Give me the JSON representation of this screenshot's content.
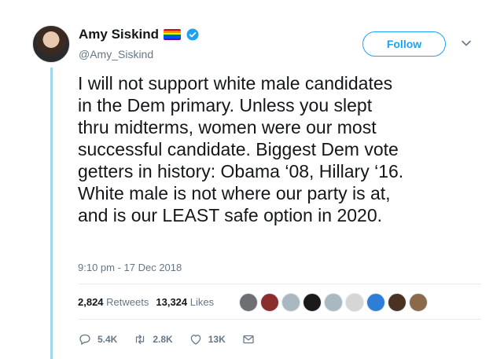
{
  "tweet": {
    "display_name": "Amy Siskind",
    "handle": "@Amy_Siskind",
    "verified_icon": "verified-badge-icon",
    "flag_icon": "rainbow-flag-icon",
    "follow_label": "Follow",
    "text_lines": [
      "I will not support white male candidates",
      "in the Dem primary. Unless you slept",
      "thru midterms, women were our most",
      "successful candidate. Biggest Dem vote",
      "getters in history: Obama ‘08, Hillary ‘16.",
      "White male is not where our party is at,",
      "and is our LEAST safe option in 2020."
    ],
    "timestamp": "9:10 pm - 17 Dec 2018"
  },
  "stats": {
    "retweets_count": "2,824",
    "retweets_label": "Retweets",
    "likes_count": "13,324",
    "likes_label": "Likes"
  },
  "actions": {
    "reply_count": "5.4K",
    "retweet_count": "2.8K",
    "like_count": "13K"
  },
  "colors": {
    "brand_blue": "#1da1f2",
    "thread_line": "#9fd8e8",
    "muted_text": "#657786"
  },
  "likers": [
    {
      "name": "liker-avatar-1",
      "color": "#6d6f73"
    },
    {
      "name": "liker-avatar-2",
      "color": "#8c2d2d"
    },
    {
      "name": "liker-avatar-3",
      "color": "#aab8c2"
    },
    {
      "name": "liker-avatar-4",
      "color": "#1a1a1a"
    },
    {
      "name": "liker-avatar-5",
      "color": "#aab8c2"
    },
    {
      "name": "liker-avatar-6",
      "color": "#d6d6d6"
    },
    {
      "name": "liker-avatar-7",
      "color": "#2e7dd6"
    },
    {
      "name": "liker-avatar-8",
      "color": "#4a3323"
    },
    {
      "name": "liker-avatar-9",
      "color": "#8a6a4a"
    }
  ]
}
